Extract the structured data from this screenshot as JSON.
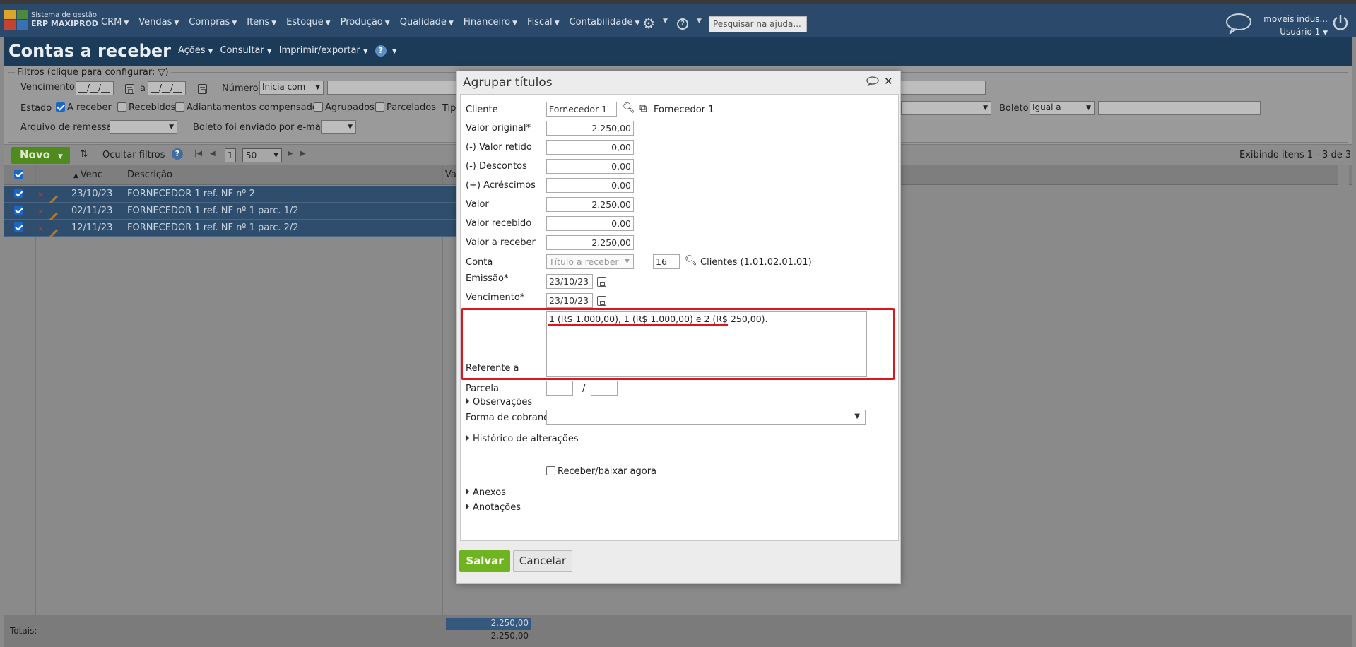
{
  "topbar": {
    "brand_line1": "Sistema de gestão",
    "brand_line2": "ERP MAXIPROD",
    "menu": [
      "CRM",
      "Vendas",
      "Compras",
      "Itens",
      "Estoque",
      "Produção",
      "Qualidade",
      "Financeiro",
      "Fiscal",
      "Contabilidade"
    ],
    "search_placeholder": "Pesquisar na ajuda...",
    "company": "moveis indus...",
    "user": "Usuário 1"
  },
  "page": {
    "title": "Contas a receber",
    "menu": [
      "Ações",
      "Consultar",
      "Imprimir/exportar"
    ]
  },
  "filters": {
    "legend": "Filtros (clique para configurar:",
    "vencimento_label": "Vencimento",
    "date_placeholder": "__/__/__",
    "a_label": "a",
    "numero_label": "Número",
    "numero_select": "Inicia com",
    "estado_label": "Estado",
    "estado_options": [
      {
        "label": "A receber",
        "checked": true
      },
      {
        "label": "Recebidos",
        "checked": false
      },
      {
        "label": "Adiantamentos compensados",
        "checked": false
      },
      {
        "label": "Agrupados",
        "checked": false
      },
      {
        "label": "Parcelados",
        "checked": false
      }
    ],
    "tipo_label": "Tip",
    "boleto_label": "Boleto",
    "boleto_select": "Igual a",
    "arquivo_label": "Arquivo de remessa",
    "boleto_email_label": "Boleto foi enviado por e-mail"
  },
  "toolbar": {
    "novo": "Novo",
    "ocultar": "Ocultar filtros",
    "page": "1",
    "page_size": "50",
    "exibindo": "Exibindo itens 1 - 3 de 3"
  },
  "grid": {
    "headers": {
      "venc": "Venc",
      "descricao": "Descrição",
      "valor": "Va"
    },
    "rows": [
      {
        "venc": "23/10/23",
        "descricao": "FORNECEDOR 1 ref. NF nº 2"
      },
      {
        "venc": "02/11/23",
        "descricao": "FORNECEDOR 1 ref. NF nº 1 parc. 1/2"
      },
      {
        "venc": "12/11/23",
        "descricao": "FORNECEDOR 1 ref. NF nº 1 parc. 2/2"
      }
    ],
    "totals_label": "Totais:",
    "total_selected": "2.250,00",
    "total_all": "2.250,00"
  },
  "modal": {
    "title": "Agrupar títulos",
    "cliente_label": "Cliente",
    "cliente_value": "Fornecedor 1",
    "cliente_link": "Fornecedor 1",
    "valor_original_label": "Valor original*",
    "valor_original": "2.250,00",
    "valor_retido_label": "(-) Valor retido",
    "valor_retido": "0,00",
    "descontos_label": "(-) Descontos",
    "descontos": "0,00",
    "acrescimos_label": "(+) Acréscimos",
    "acrescimos": "0,00",
    "valor_label": "Valor",
    "valor": "2.250,00",
    "valor_recebido_label": "Valor recebido",
    "valor_recebido": "0,00",
    "valor_a_receber_label": "Valor a receber",
    "valor_a_receber": "2.250,00",
    "conta_label": "Conta",
    "conta_select": "Título a receber",
    "conta_code": "16",
    "conta_desc": "Clientes (1.01.02.01.01)",
    "emissao_label": "Emissão*",
    "emissao": "23/10/23",
    "vencimento_label": "Vencimento*",
    "vencimento": "23/10/23",
    "referente_label": "Referente a",
    "referente": "1 (R$ 1.000,00), 1 (R$ 1.000,00) e 2 (R$ 250,00).",
    "parcela_label": "Parcela",
    "parcela_sep": "/",
    "observacoes": "Observações",
    "forma_label": "Forma de cobrança",
    "historico": "Histórico de alterações",
    "receber_agora": "Receber/baixar agora",
    "anexos": "Anexos",
    "anotacoes": "Anotações",
    "salvar": "Salvar",
    "cancelar": "Cancelar"
  }
}
